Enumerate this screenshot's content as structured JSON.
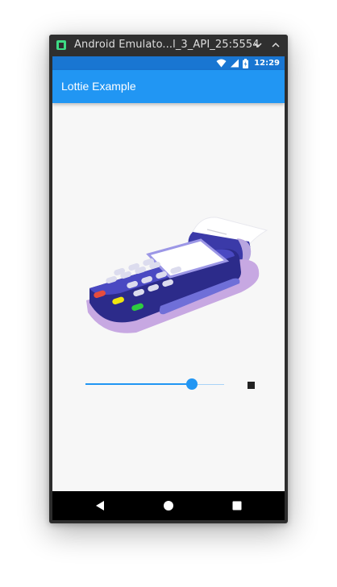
{
  "window": {
    "title": "Android Emulato...l_3_API_25:5554",
    "icons": {
      "app": "android-emulator-icon",
      "minimize": "chevron-down-icon",
      "maximize": "chevron-up-icon"
    }
  },
  "status_bar": {
    "time": "12:29",
    "icons": [
      "wifi-icon",
      "signal-icon",
      "battery-icon"
    ]
  },
  "app_bar": {
    "title": "Lottie Example"
  },
  "animation": {
    "subject": "card-payment-terminal-illustration",
    "progress": 0.77
  },
  "controls": {
    "stop_icon": "stop-icon"
  },
  "nav_bar": {
    "icons": [
      "back-icon",
      "home-icon",
      "recents-icon"
    ]
  },
  "colors": {
    "status_bar": "#1976d2",
    "app_bar": "#2196f3",
    "accent": "#2196f3",
    "screen_bg": "#f7f7f7"
  }
}
